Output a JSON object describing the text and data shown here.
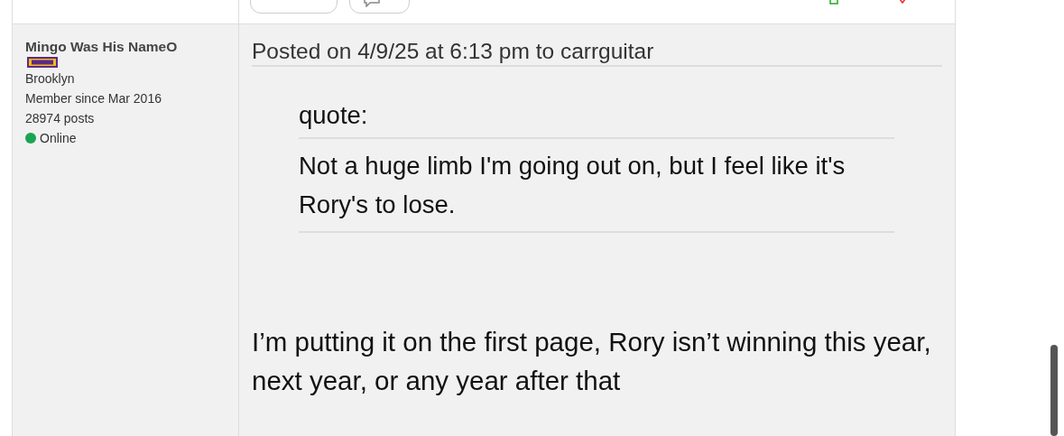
{
  "author": {
    "name": "Mingo Was His NameO",
    "location": "Brooklyn",
    "member_since": "Member since Mar 2016",
    "posts": "28974 posts",
    "status": "Online",
    "online": true
  },
  "post": {
    "header": "Posted on 4/9/25 at 6:13 pm to carrguitar",
    "quote": {
      "label": "quote:",
      "text": "Not a huge limb I'm going out on, but I feel like it's Rory's to lose."
    },
    "body": "I’m putting it on the first page, Rory isn’t winning this year, next year, or any year after that"
  }
}
